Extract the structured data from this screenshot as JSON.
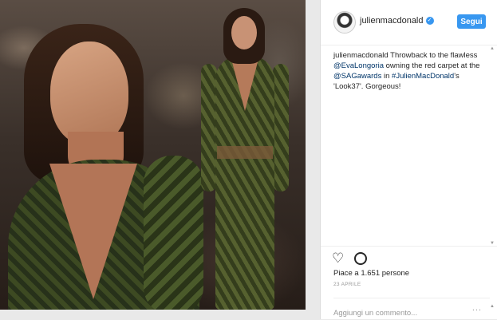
{
  "post": {
    "username": "julienmacdonald",
    "follow_label": "Segui",
    "caption": {
      "username": "julienmacdonald",
      "part1": " Throwback to the flawless ",
      "mention1": "@EvaLongoria",
      "part2": " owning the red carpet at the ",
      "mention2": "@SAGawards",
      "part3": " in ",
      "hashtag": "#JulienMacDonald",
      "part4": "'s 'Look37'. Gorgeous!"
    },
    "likes": "Piace a 1.651 persone",
    "date": "23 APRILE",
    "comment_placeholder": "Aggiungi un commento...",
    "more_label": "..."
  },
  "colors": {
    "accent": "#3897f0",
    "link": "#003569",
    "text": "#262626",
    "muted": "#999999"
  },
  "icons": [
    "verified-icon",
    "heart-icon",
    "comment-icon",
    "more-options-icon",
    "scroll-up-icon",
    "scroll-down-icon"
  ]
}
